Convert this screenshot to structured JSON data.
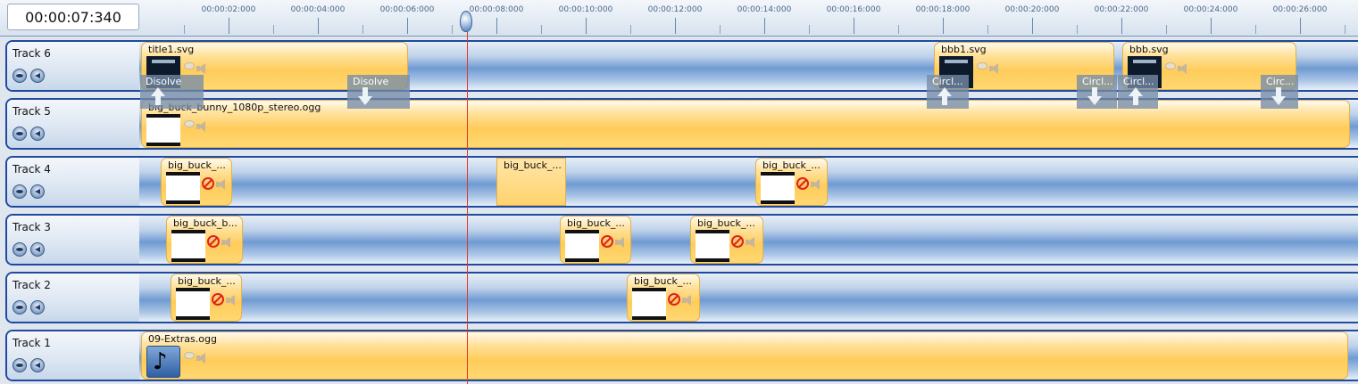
{
  "timecode": "00:00:07:340",
  "ruler": {
    "labels": [
      "00:00:02:000",
      "00:00:04:000",
      "00:00:06:000",
      "00:00:08:000",
      "00:00:10:000",
      "00:00:12:000",
      "00:00:14:000",
      "00:00:16:000",
      "00:00:18:000",
      "00:00:20:000",
      "00:00:22:000",
      "00:00:24:000",
      "00:00:26:000"
    ]
  },
  "tracks": [
    {
      "name": "Track 6",
      "clips": [
        {
          "title": "title1.svg",
          "thumb": "dark"
        },
        {
          "title": "bbb1.svg",
          "thumb": "dark"
        },
        {
          "title": "bbb.svg",
          "thumb": "dark"
        }
      ]
    },
    {
      "name": "Track 5",
      "clips": [
        {
          "title": "big_buck_bunny_1080p_stereo.ogg",
          "thumb": "white"
        }
      ]
    },
    {
      "name": "Track 4",
      "clips": [
        {
          "title": "big_buck_...",
          "thumb": "white",
          "no_video": true
        },
        {
          "title": "big_buck_...",
          "thumb": "none"
        },
        {
          "title": "big_buck_...",
          "thumb": "white",
          "no_video": true
        }
      ]
    },
    {
      "name": "Track 3",
      "clips": [
        {
          "title": "big_buck_b...",
          "thumb": "white",
          "no_video": true
        },
        {
          "title": "big_buck_...",
          "thumb": "white",
          "no_video": true
        },
        {
          "title": "big_buck_...",
          "thumb": "white",
          "no_video": true
        }
      ]
    },
    {
      "name": "Track 2",
      "clips": [
        {
          "title": "big_buck_...",
          "thumb": "white",
          "no_video": true
        },
        {
          "title": "big_buck_...",
          "thumb": "white",
          "no_video": true
        }
      ]
    },
    {
      "name": "Track 1",
      "clips": [
        {
          "title": "09-Extras.ogg",
          "thumb": "music"
        }
      ]
    }
  ],
  "transitions": [
    {
      "label": "Disolve",
      "direction": "up"
    },
    {
      "label": "Disolve",
      "direction": "down"
    },
    {
      "label": "Circl...",
      "direction": "up"
    },
    {
      "label": "Circl...",
      "direction": "down"
    },
    {
      "label": "Circl...",
      "direction": "up"
    },
    {
      "label": "Circ...",
      "direction": "down"
    }
  ]
}
